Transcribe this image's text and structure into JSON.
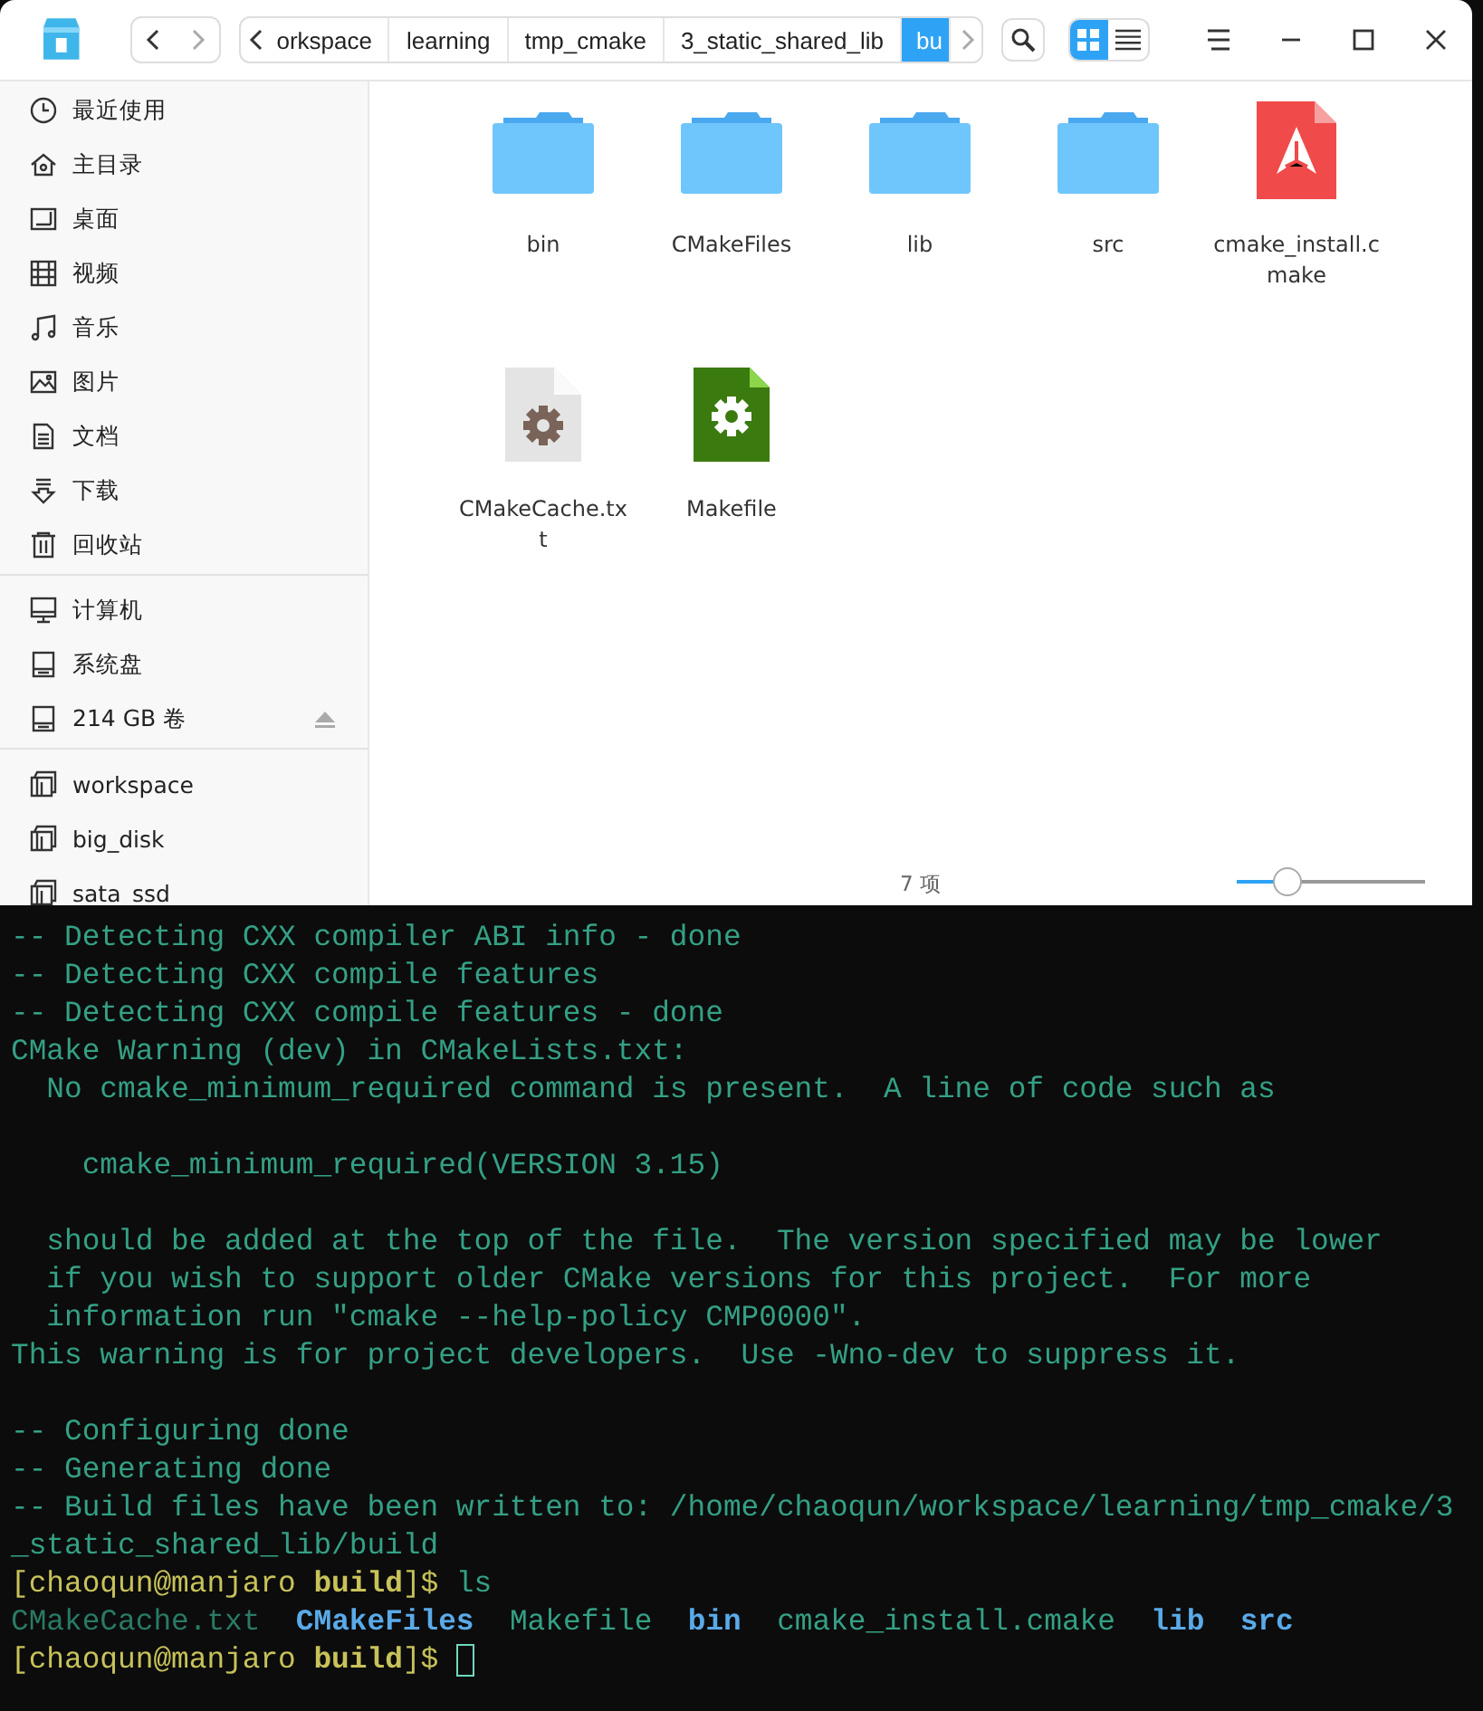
{
  "file_manager": {
    "breadcrumbs": [
      {
        "label": "orkspace",
        "selected": false
      },
      {
        "label": "learning",
        "selected": false
      },
      {
        "label": "tmp_cmake",
        "selected": false
      },
      {
        "label": "3_static_shared_lib",
        "selected": false
      },
      {
        "label": "bu",
        "selected": true
      }
    ],
    "view_modes": [
      {
        "kind": "icons",
        "selected": true
      },
      {
        "kind": "list",
        "selected": false
      }
    ],
    "sidebar": {
      "groups": [
        {
          "items": [
            {
              "label": "最近使用",
              "kind": "recent"
            },
            {
              "label": "主目录",
              "kind": "home"
            },
            {
              "label": "桌面",
              "kind": "desktop"
            },
            {
              "label": "视频",
              "kind": "videos"
            },
            {
              "label": "音乐",
              "kind": "music"
            },
            {
              "label": "图片",
              "kind": "pictures"
            },
            {
              "label": "文档",
              "kind": "documents"
            },
            {
              "label": "下载",
              "kind": "downloads"
            },
            {
              "label": "回收站",
              "kind": "trash"
            }
          ]
        },
        {
          "items": [
            {
              "label": "计算机",
              "kind": "computer"
            },
            {
              "label": "系统盘",
              "kind": "disk"
            },
            {
              "label": "214 GB 卷",
              "kind": "disk",
              "ejectable": true
            }
          ]
        },
        {
          "items": [
            {
              "label": "workspace",
              "kind": "bookmark"
            },
            {
              "label": "big_disk",
              "kind": "bookmark"
            },
            {
              "label": "sata_ssd",
              "kind": "bookmark"
            }
          ]
        }
      ]
    },
    "files": [
      {
        "name": "bin",
        "kind": "folder"
      },
      {
        "name": "CMakeFiles",
        "kind": "folder"
      },
      {
        "name": "lib",
        "kind": "folder"
      },
      {
        "name": "src",
        "kind": "folder"
      },
      {
        "name": "cmake_install.cmake",
        "kind": "cmake"
      },
      {
        "name": "CMakeCache.txt",
        "kind": "text"
      },
      {
        "name": "Makefile",
        "kind": "makefile"
      }
    ],
    "status": {
      "item_count": "7 项",
      "zoom": {
        "level": 0.27
      }
    }
  },
  "terminal": {
    "lines": [
      {
        "kind": "text",
        "segments": [
          {
            "text": "-- Detecting CXX compiler ABI info - done",
            "kind": "output"
          }
        ]
      },
      {
        "kind": "text",
        "segments": [
          {
            "text": "-- Detecting CXX compile features",
            "kind": "output"
          }
        ]
      },
      {
        "kind": "text",
        "segments": [
          {
            "text": "-- Detecting CXX compile features - done",
            "kind": "output"
          }
        ]
      },
      {
        "kind": "text",
        "segments": [
          {
            "text": "CMake Warning (dev) in CMakeLists.txt:",
            "kind": "output"
          }
        ]
      },
      {
        "kind": "text",
        "segments": [
          {
            "text": "  No cmake_minimum_required command is present.  A line of code such as",
            "kind": "output"
          }
        ]
      },
      {
        "kind": "blank"
      },
      {
        "kind": "text",
        "segments": [
          {
            "text": "    cmake_minimum_required(VERSION 3.15)",
            "kind": "output"
          }
        ]
      },
      {
        "kind": "blank"
      },
      {
        "kind": "text",
        "segments": [
          {
            "text": "  should be added at the top of the file.  The version specified may be lower",
            "kind": "output"
          }
        ]
      },
      {
        "kind": "text",
        "segments": [
          {
            "text": "  if you wish to support older CMake versions for this project.  For more",
            "kind": "output"
          }
        ]
      },
      {
        "kind": "text",
        "segments": [
          {
            "text": "  information run \"cmake --help-policy CMP0000\".",
            "kind": "output"
          }
        ]
      },
      {
        "kind": "text",
        "segments": [
          {
            "text": "This warning is for project developers.  Use -Wno-dev to suppress it.",
            "kind": "output"
          }
        ]
      },
      {
        "kind": "blank"
      },
      {
        "kind": "text",
        "segments": [
          {
            "text": "-- Configuring done",
            "kind": "output"
          }
        ]
      },
      {
        "kind": "text",
        "segments": [
          {
            "text": "-- Generating done",
            "kind": "output"
          }
        ]
      },
      {
        "kind": "text",
        "segments": [
          {
            "text": "-- Build files have been written to: /home/chaoqun/workspace/learning/tmp_cmake/3",
            "kind": "output"
          }
        ]
      },
      {
        "kind": "text",
        "segments": [
          {
            "text": "_static_shared_lib/build",
            "kind": "output"
          }
        ]
      },
      {
        "kind": "text",
        "segments": [
          {
            "text": "[chaoqun@manjaro ",
            "kind": "prompt"
          },
          {
            "text": "build",
            "kind": "prompt-dir"
          },
          {
            "text": "]$ ",
            "kind": "prompt"
          },
          {
            "text": "ls",
            "kind": "output"
          }
        ]
      },
      {
        "kind": "listing",
        "entries": [
          {
            "text": "CMakeCache.txt",
            "kind": "file"
          },
          {
            "text": "CMakeFiles",
            "kind": "dir"
          },
          {
            "text": "Makefile",
            "kind": "output"
          },
          {
            "text": "bin",
            "kind": "dir"
          },
          {
            "text": "cmake_install.cmake",
            "kind": "output"
          },
          {
            "text": "lib",
            "kind": "dir"
          },
          {
            "text": "src",
            "kind": "dir"
          }
        ]
      },
      {
        "kind": "text",
        "cursor": true,
        "segments": [
          {
            "text": "[chaoqun@manjaro ",
            "kind": "prompt"
          },
          {
            "text": "build",
            "kind": "prompt-dir"
          },
          {
            "text": "]$ ",
            "kind": "prompt"
          }
        ]
      }
    ]
  }
}
